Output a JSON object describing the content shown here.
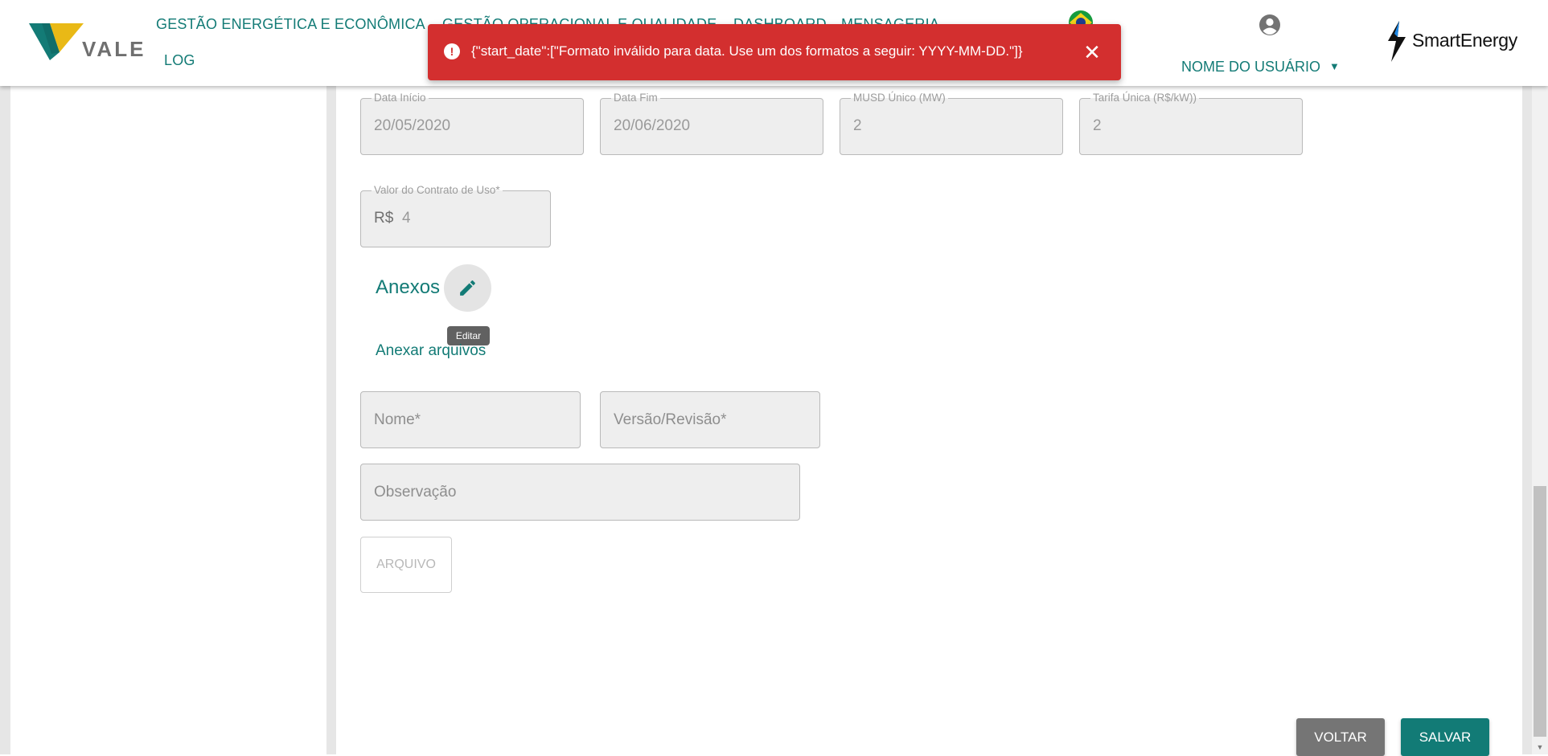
{
  "header": {
    "logo_text": "VALE",
    "nav": [
      "GESTÃO ENERGÉTICA E ECONÔMICA",
      "GESTÃO OPERACIONAL E QUALIDADE",
      "DASHBOARD",
      "MENSAGERIA",
      "LOG"
    ],
    "user_name": "NOME DO USUÁRIO",
    "brand_text": "SmartEnergy"
  },
  "toast": {
    "message": "{\"start_date\":[\"Formato inválido para data. Use um dos formatos a seguir: YYYY-MM-DD.\"]}",
    "color": "#d32f2f"
  },
  "form": {
    "start_date": {
      "label": "Data Início",
      "value": "20/05/2020"
    },
    "end_date": {
      "label": "Data Fim",
      "value": "20/06/2020"
    },
    "musd": {
      "label": "MUSD Único (MW)",
      "value": "2"
    },
    "tariff": {
      "label": "Tarifa Única (R$/kW))",
      "value": "2"
    },
    "contract_value": {
      "label": "Valor do Contrato de Uso*",
      "prefix": "R$",
      "value": "4"
    }
  },
  "attachments": {
    "title": "Anexos",
    "edit_tooltip": "Editar",
    "attach_link": "Anexar arquivos",
    "name_placeholder": "Nome*",
    "version_placeholder": "Versão/Revisão*",
    "notes_placeholder": "Observação",
    "file_button": "ARQUIVO"
  },
  "actions": {
    "back": "VOLTAR",
    "save": "SALVAR"
  },
  "colors": {
    "accent": "#137b76",
    "error": "#d32f2f",
    "back_button": "#757575"
  }
}
